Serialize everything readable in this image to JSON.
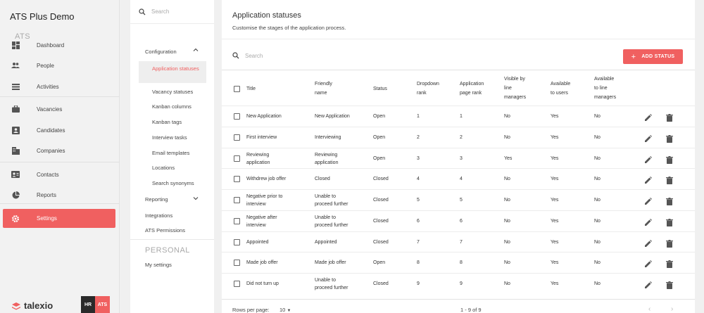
{
  "app_title": "ATS Plus Demo",
  "nav": [
    {
      "label": "Dashboard",
      "icon": "dashboard-icon"
    },
    {
      "label": "People",
      "icon": "people-icon"
    },
    {
      "label": "Activities",
      "icon": "activities-icon"
    },
    {
      "label": "Vacancies",
      "icon": "briefcase-icon"
    },
    {
      "label": "Candidates",
      "icon": "candidates-icon"
    },
    {
      "label": "Companies",
      "icon": "companies-icon"
    },
    {
      "label": "Contacts",
      "icon": "contacts-icon"
    },
    {
      "label": "Reports",
      "icon": "pie-chart-icon"
    },
    {
      "label": "Settings",
      "icon": "gear-icon"
    }
  ],
  "logo_text": "talexio",
  "badge": {
    "hr": "HR",
    "ats": "ATS"
  },
  "settings_nav": {
    "search_placeholder": "Search",
    "section_ats": "ATS",
    "configuration": "Configuration",
    "items": [
      "Application statuses",
      "Vacancy statuses",
      "Kanban columns",
      "Kanban tags",
      "Interview tasks",
      "Email templates",
      "Locations",
      "Search synonyms"
    ],
    "reporting": "Reporting",
    "integrations": "Integrations",
    "ats_permissions": "ATS Permissions",
    "section_personal": "PERSONAL",
    "my_settings": "My settings"
  },
  "main": {
    "title": "Application statuses",
    "subtitle": "Customise the stages of the application process.",
    "search_placeholder": "Search",
    "add_button": "ADD STATUS"
  },
  "columns": [
    [
      "Title"
    ],
    [
      "Friendly",
      "name"
    ],
    [
      "Status"
    ],
    [
      "Dropdown",
      "rank"
    ],
    [
      "Application",
      "page rank"
    ],
    [
      "Visible by",
      "line",
      "managers"
    ],
    [
      "Available",
      "to users"
    ],
    [
      "Available",
      "to line",
      "managers"
    ]
  ],
  "rows": [
    {
      "title": [
        "New Application"
      ],
      "friendly": [
        "New Application"
      ],
      "status": "Open",
      "dropdown": "1",
      "page": "1",
      "visible": "No",
      "users": "Yes",
      "line": "No"
    },
    {
      "title": [
        "First interview"
      ],
      "friendly": [
        "Interviewing"
      ],
      "status": "Open",
      "dropdown": "2",
      "page": "2",
      "visible": "No",
      "users": "Yes",
      "line": "No"
    },
    {
      "title": [
        "Reviewing",
        "application"
      ],
      "friendly": [
        "Reviewing",
        "application"
      ],
      "status": "Open",
      "dropdown": "3",
      "page": "3",
      "visible": "Yes",
      "users": "Yes",
      "line": "No"
    },
    {
      "title": [
        "Withdrew job offer"
      ],
      "friendly": [
        "Closed"
      ],
      "status": "Closed",
      "dropdown": "4",
      "page": "4",
      "visible": "No",
      "users": "Yes",
      "line": "No"
    },
    {
      "title": [
        "Negative prior to",
        "interview"
      ],
      "friendly": [
        "Unable to",
        "proceed further"
      ],
      "status": "Closed",
      "dropdown": "5",
      "page": "5",
      "visible": "No",
      "users": "Yes",
      "line": "No"
    },
    {
      "title": [
        "Negative after",
        "interview"
      ],
      "friendly": [
        "Unable to",
        "proceed further"
      ],
      "status": "Closed",
      "dropdown": "6",
      "page": "6",
      "visible": "No",
      "users": "Yes",
      "line": "No"
    },
    {
      "title": [
        "Appointed"
      ],
      "friendly": [
        "Appointed"
      ],
      "status": "Closed",
      "dropdown": "7",
      "page": "7",
      "visible": "No",
      "users": "Yes",
      "line": "No"
    },
    {
      "title": [
        "Made job offer"
      ],
      "friendly": [
        "Made job offer"
      ],
      "status": "Open",
      "dropdown": "8",
      "page": "8",
      "visible": "No",
      "users": "Yes",
      "line": "No"
    },
    {
      "title": [
        "Did not turn up"
      ],
      "friendly": [
        "Unable to",
        "proceed further"
      ],
      "status": "Closed",
      "dropdown": "9",
      "page": "9",
      "visible": "No",
      "users": "Yes",
      "line": "No"
    }
  ],
  "footer": {
    "rows_per_page_label": "Rows per page:",
    "rows_per_page": "10",
    "range": "1 - 9 of 9"
  },
  "colors": {
    "accent": "#f06060"
  }
}
